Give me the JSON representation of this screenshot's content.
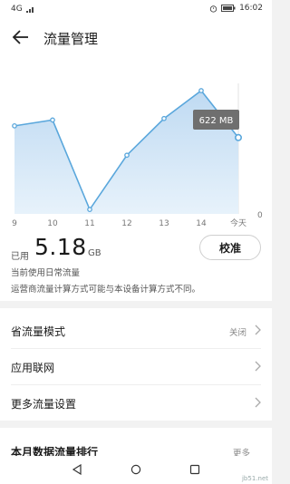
{
  "status_bar": {
    "network": "4G",
    "time": "16:02"
  },
  "header": {
    "title": "流量管理"
  },
  "chart_data": {
    "type": "area",
    "categories": [
      "9",
      "10",
      "11",
      "12",
      "13",
      "14",
      "今天"
    ],
    "values": [
      600,
      640,
      30,
      400,
      650,
      840,
      520
    ],
    "y_zero_label": "0",
    "tooltip": "622 MB",
    "colors": {
      "line": "#5aa7dc",
      "fill_top": "#bfdaf2",
      "fill_bottom": "#e7f2fb"
    }
  },
  "usage": {
    "used_label": "已用",
    "used_value": "5.18",
    "used_unit": "GB",
    "calibrate_label": "校准",
    "plan_text": "当前使用日常流量",
    "note_text": "运营商流量计算方式可能与本设备计算方式不同。"
  },
  "settings": {
    "items": [
      {
        "label": "省流量模式",
        "value": "关闭"
      },
      {
        "label": "应用联网",
        "value": ""
      },
      {
        "label": "更多流量设置",
        "value": ""
      }
    ]
  },
  "ranking": {
    "title": "本月数据流量排行",
    "more_label": "更多"
  },
  "watermark": "jb51.net"
}
